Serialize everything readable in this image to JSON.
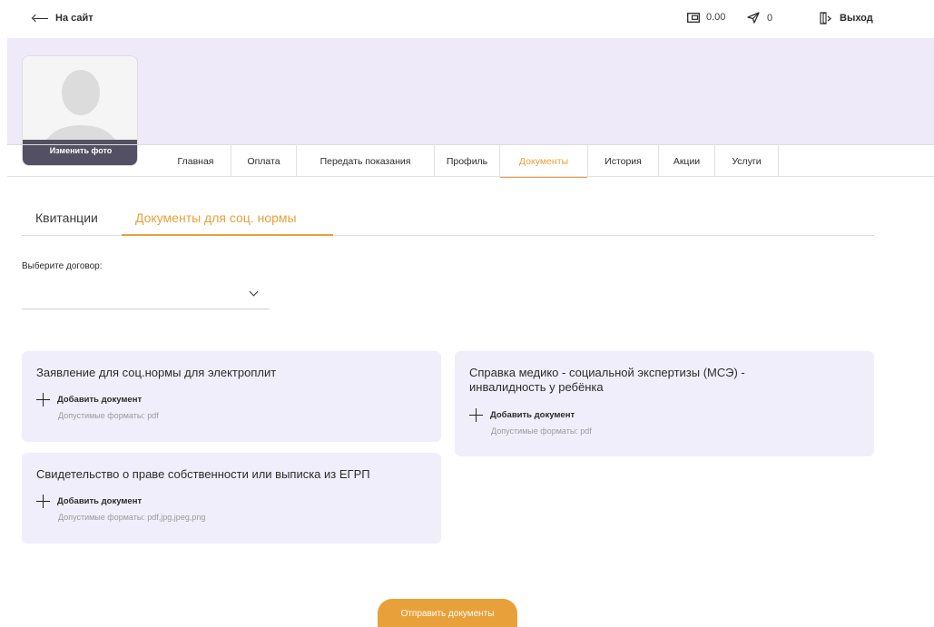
{
  "topbar": {
    "back_label": "На сайт",
    "balance": "0.00",
    "messages": "0",
    "logout_label": "Выход"
  },
  "avatar": {
    "change_photo_label": "Изменить фото"
  },
  "nav": {
    "items": [
      {
        "label": "Главная"
      },
      {
        "label": "Оплата"
      },
      {
        "label": "Передать показания"
      },
      {
        "label": "Профиль"
      },
      {
        "label": "Документы",
        "active": true
      },
      {
        "label": "История"
      },
      {
        "label": "Акции"
      },
      {
        "label": "Услуги"
      }
    ]
  },
  "subtabs": {
    "receipts": "Квитанции",
    "social_docs": "Документы для соц. нормы",
    "active": "social_docs"
  },
  "contract": {
    "label": "Выберите договор:",
    "value": ""
  },
  "documents": [
    {
      "title": "Заявление для соц.нормы для электроплит",
      "add_label": "Добавить документ",
      "formats": "Допустимые форматы: pdf"
    },
    {
      "title": "Справка медико - социальной экспертизы (МСЭ) - инвалидность у ребёнка",
      "add_label": "Добавить документ",
      "formats": "Допустимые форматы: pdf"
    },
    {
      "title": "Свидетельство о праве собственности или выписка из ЕГРП",
      "add_label": "Добавить документ",
      "formats": "Допустимые форматы: pdf,jpg,jpeg,png"
    }
  ],
  "submit_label": "Отправить документы",
  "colors": {
    "accent": "#e8a13a",
    "banner": "#eeeaf9",
    "card": "#f1eefb",
    "avatar_button": "#545063"
  },
  "icons": {
    "back": "arrow-left-icon",
    "wallet": "wallet-icon",
    "messages": "paper-plane-icon",
    "logout": "logout-icon",
    "dropdown": "chevron-down-icon",
    "add": "plus-icon"
  }
}
